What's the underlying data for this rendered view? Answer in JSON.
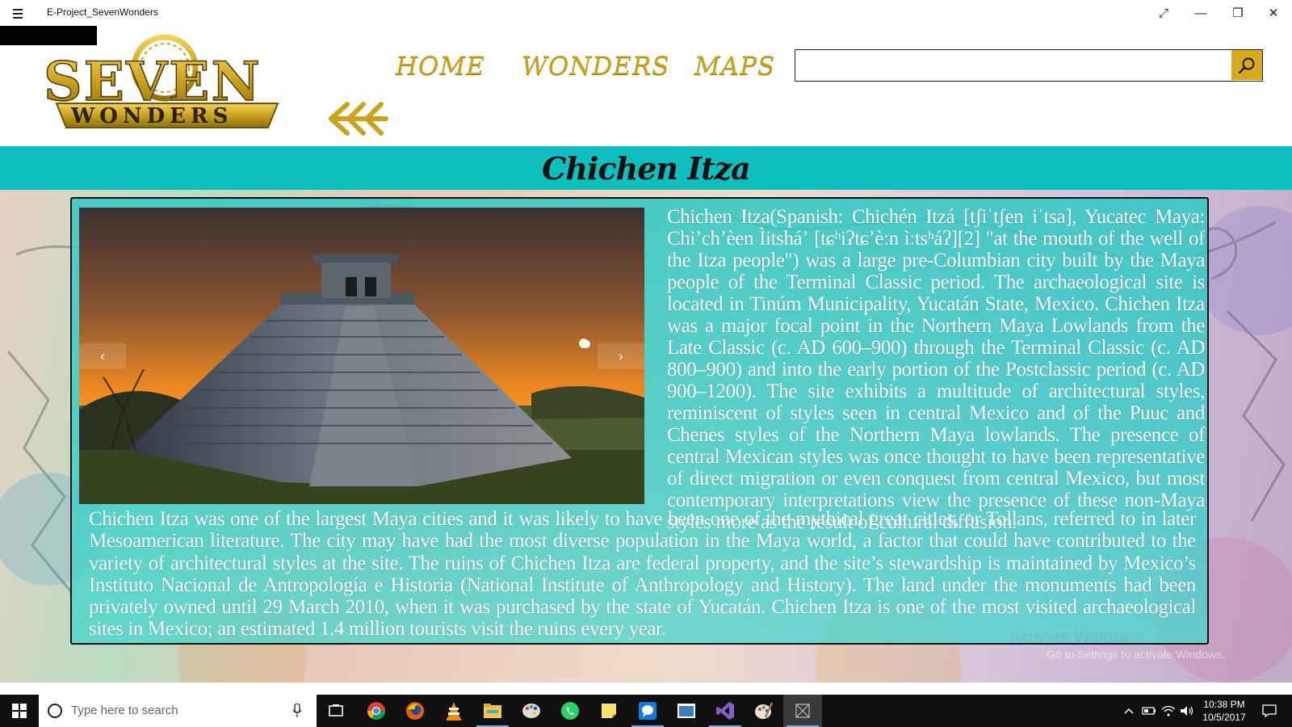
{
  "window": {
    "title": "E-Project_SevenWonders"
  },
  "logo": {
    "line1": "SEVEN",
    "line2": "WONDERS"
  },
  "nav": {
    "home": "HOME",
    "wonders": "WONDERS",
    "maps": "MAPS"
  },
  "search": {
    "value": "",
    "placeholder": ""
  },
  "page": {
    "title": "Chichen Itza"
  },
  "content": {
    "paragraph1": "Chichen Itza(Spanish: Chichén Itzá [tʃiˈtʃen iˈtsa], Yucatec Maya: Chiʼchʼèen Ìitsháʼ [tɕʰiʔtɕʼèːn ìːtsʰáʔ][2] \"at the mouth of the well of the Itza people\") was a large pre-Columbian city built by the Maya people of the Terminal Classic period. The archaeological site is located in Tinúm Municipality, Yucatán State, Mexico. Chichen Itza was a major focal point in the Northern Maya Lowlands from the Late Classic (c. AD 600–900) through the Terminal Classic (c. AD 800–900) and into the early portion of the Postclassic period (c. AD 900–1200). The site exhibits a multitude of architectural styles, reminiscent of styles seen in central Mexico and of the Puuc and Chenes styles of the Northern Maya lowlands. The presence of central Mexican styles was once thought to have been representative of direct migration or even conquest from central Mexico, but most contemporary interpretations view the presence of these non-Maya styles more as the result of cultural diffusion.",
    "paragraph2": "Chichen Itza was one of the largest Maya cities and it was likely to have been one of the mythical great cities, or Tollans, referred to in later Mesoamerican literature. The city may have had the most diverse population in the Maya world, a factor that could have contributed to the variety of architectural styles at the site. The ruins of Chichen Itza are federal property, and the site’s stewardship is maintained by Mexico’s Instituto Nacional de Antropología e Historia (National Institute of Anthropology and History). The land under the monuments had been privately owned until 29 March 2010, when it was purchased by the state of Yucatán. Chichen Itza is one of the most visited archaeological sites in Mexico; an estimated 1.4 million tourists visit the ruins every year."
  },
  "carousel": {
    "prev_label": "‹",
    "next_label": "›"
  },
  "watermark": {
    "title": "Activate Windows",
    "subtitle": "Go to Settings to activate Windows."
  },
  "taskbar": {
    "search_placeholder": "Type here to search",
    "time": "10:38 PM",
    "date": "10/5/2017"
  },
  "colors": {
    "gold": "#caa21c",
    "teal_band": "#0fbfbf",
    "panel_teal": "#30c8c4"
  }
}
